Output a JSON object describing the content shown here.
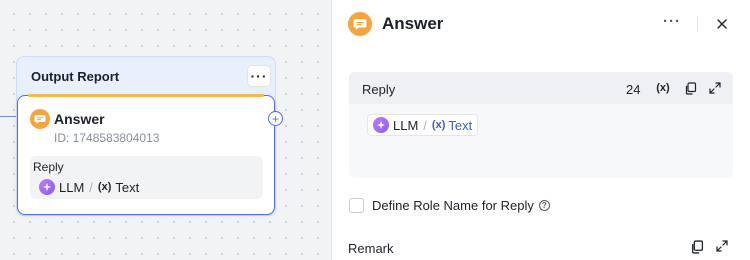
{
  "canvas": {
    "group": {
      "title": "Output Report",
      "more_label": "···"
    },
    "node": {
      "title": "Answer",
      "id_text": "ID: 1748583804013",
      "port_label": "+",
      "reply_label": "Reply",
      "reply_source": "LLM",
      "reply_separator": "/",
      "reply_var_glyph": "(x)",
      "reply_variable": "Text"
    }
  },
  "panel": {
    "title": "Answer",
    "more_label": "···",
    "reply": {
      "label": "Reply",
      "count": "24",
      "var_glyph": "(x)",
      "chip_source": "LLM",
      "chip_separator": "/",
      "chip_var_glyph": "(x)",
      "chip_variable": "Text"
    },
    "role_checkbox_label": "Define Role Name for Reply",
    "help_glyph": "?",
    "remark_label": "Remark"
  },
  "colors": {
    "accent": "#4d6bfe",
    "answer_icon": "#f7a53b",
    "llm_badge": "#a46bf7",
    "variable_link": "#3a5bdc"
  }
}
